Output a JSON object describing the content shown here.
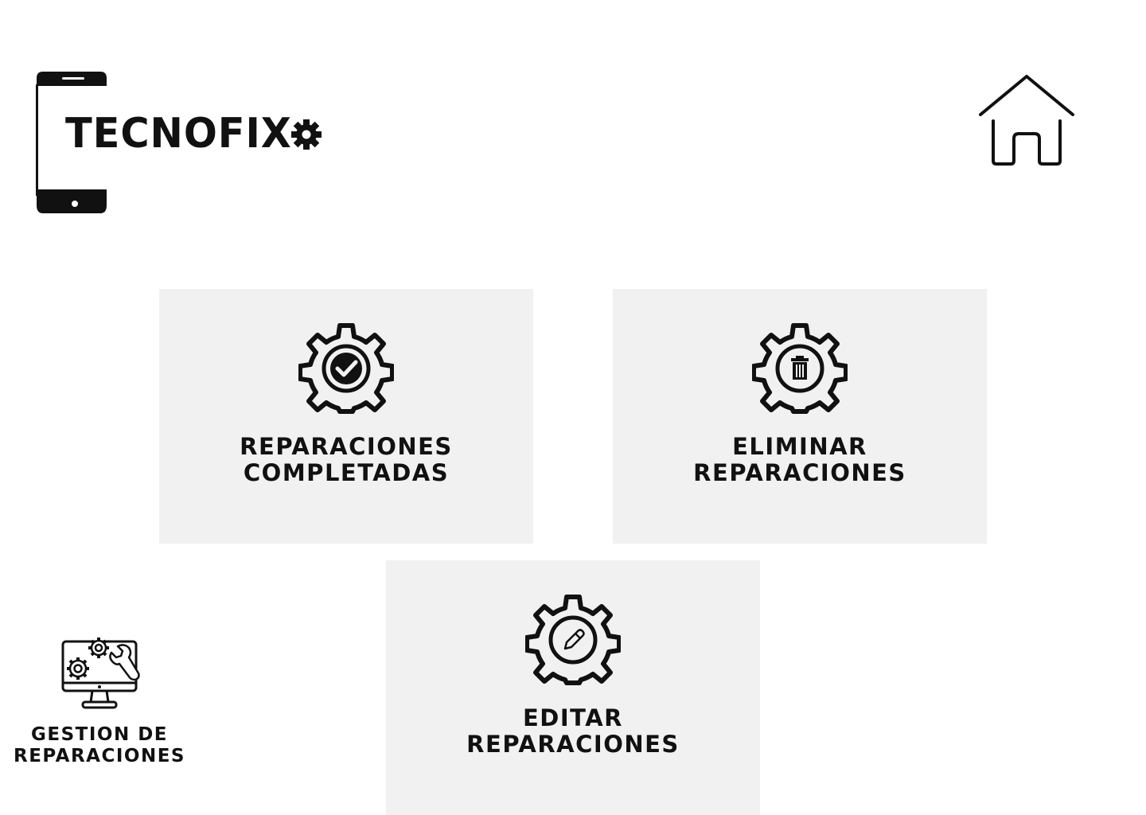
{
  "brand": {
    "name": "TECNOFIX"
  },
  "header": {
    "home_icon": "home-icon"
  },
  "cards": {
    "completed": {
      "line1": "REPARACIONES",
      "line2": "COMPLETADAS",
      "icon": "gear-check-icon"
    },
    "delete": {
      "line1": "ELIMINAR",
      "line2": "REPARACIONES",
      "icon": "gear-trash-icon"
    },
    "edit": {
      "line1": "EDITAR",
      "line2": "REPARACIONES",
      "icon": "gear-pencil-icon"
    }
  },
  "section": {
    "line1": "GESTION DE",
    "line2": "REPARACIONES",
    "icon": "monitor-repair-icon"
  },
  "colors": {
    "card_background": "#f1f1f1",
    "ink": "#111111",
    "page_background": "#ffffff"
  }
}
